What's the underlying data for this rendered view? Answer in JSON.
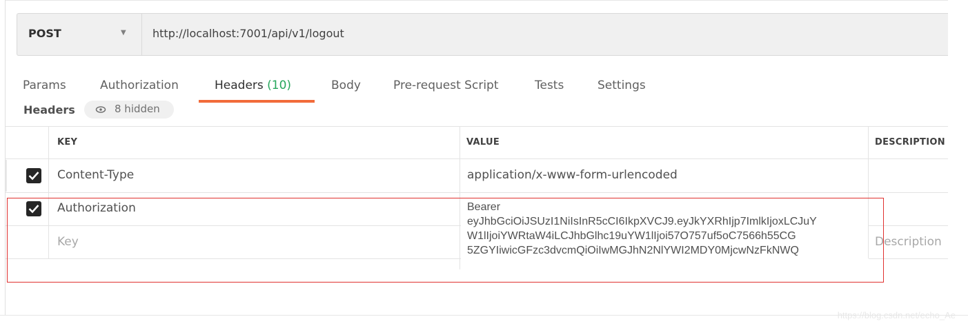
{
  "request": {
    "method": "POST",
    "url": "http://localhost:7001/api/v1/logout"
  },
  "tabs": [
    {
      "label": "Params"
    },
    {
      "label": "Authorization"
    },
    {
      "label": "Headers",
      "count": "(10)"
    },
    {
      "label": "Body"
    },
    {
      "label": "Pre-request Script"
    },
    {
      "label": "Tests"
    },
    {
      "label": "Settings"
    }
  ],
  "headers_section": {
    "title": "Headers",
    "hidden_label": "8 hidden"
  },
  "table": {
    "columns": [
      "KEY",
      "VALUE",
      "DESCRIPTION"
    ],
    "rows": [
      {
        "checked": true,
        "key": "Content-Type",
        "value": "application/x-www-form-urlencoded"
      },
      {
        "checked": true,
        "key": "Authorization"
      }
    ],
    "new_row": {
      "key_placeholder": "Key",
      "description_placeholder": "Description"
    },
    "auth_value_lines": [
      "Bearer",
      "eyJhbGciOiJSUzI1NiIsInR5cCI6IkpXVCJ9.eyJkYXRhIjp7ImlkIjoxLCJuY",
      "W1lIjoiYWRtaW4iLCJhbGlhc19uYW1lIjoi57O757uf5oC7566h55CG",
      "5ZGYIiwicGFzc3dvcmQiOiIwMGJhN2NlYWI2MDY0MjcwNzFkNWQ"
    ]
  },
  "watermark": "https://blog.csdn.net/echo_Ae",
  "colors": {
    "accent_tab": "#f26b3a",
    "count_green": "#26a65b",
    "highlight": "#e0302e"
  }
}
